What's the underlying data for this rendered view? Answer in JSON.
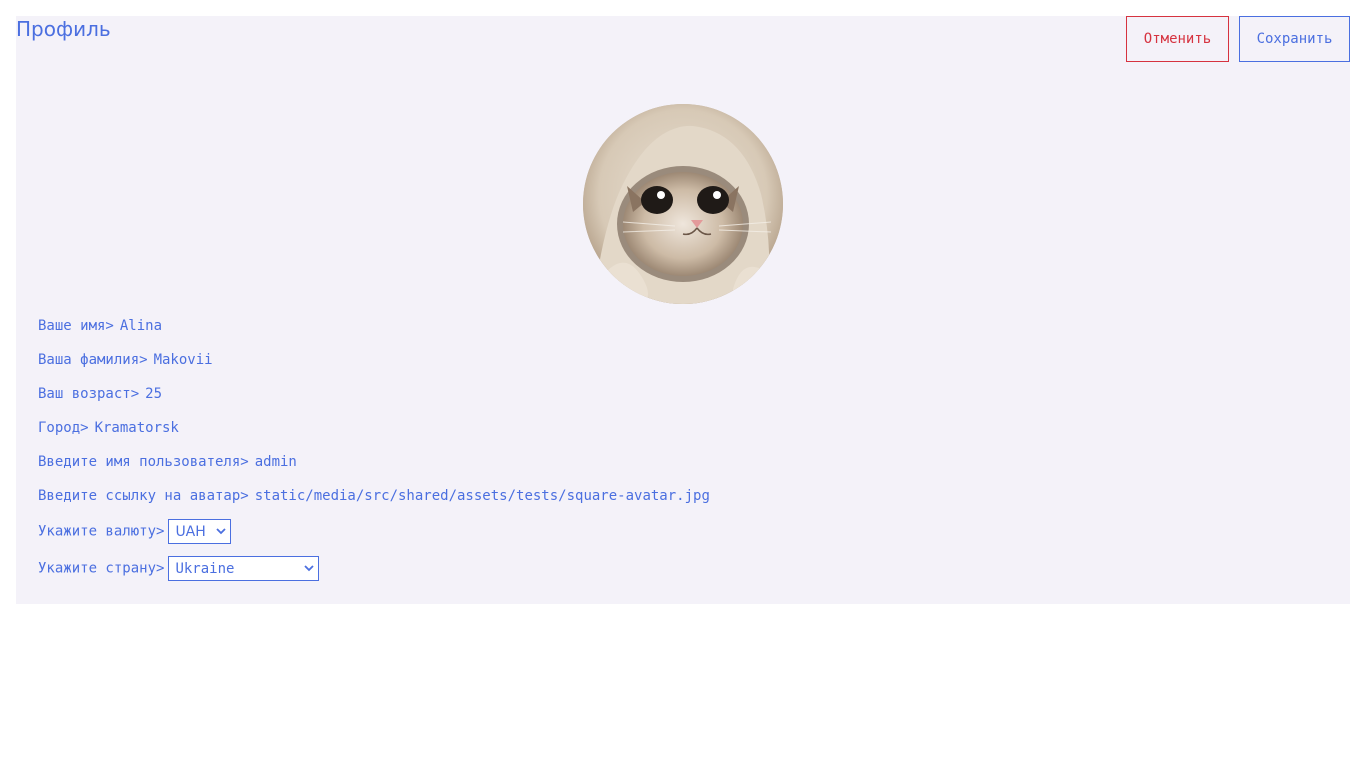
{
  "header": {
    "title": "Профиль",
    "cancel_label": "Отменить",
    "save_label": "Сохранить"
  },
  "colors": {
    "accent": "#4b6fe0",
    "danger": "#d63340",
    "card_background": "#f4f2f9"
  },
  "avatar": {
    "alt": "cat in a hood avatar"
  },
  "form": {
    "first_name": {
      "label": "Ваше имя>",
      "value": "Alina"
    },
    "last_name": {
      "label": "Ваша фамилия>",
      "value": "Makovii"
    },
    "age": {
      "label": "Ваш возраст>",
      "value": "25"
    },
    "city": {
      "label": "Город>",
      "value": "Kramatorsk"
    },
    "username": {
      "label": "Введите имя пользователя>",
      "value": "admin"
    },
    "avatar_link": {
      "label": "Введите ссылку на аватар>",
      "value": "static/media/src/shared/assets/tests/square-avatar.jpg"
    },
    "currency": {
      "label": "Укажите валюту>",
      "selected": "UAH"
    },
    "country": {
      "label": "Укажите страну>",
      "selected": "Ukraine"
    }
  },
  "icons": {
    "select_arrow": "chevron-down-icon"
  }
}
